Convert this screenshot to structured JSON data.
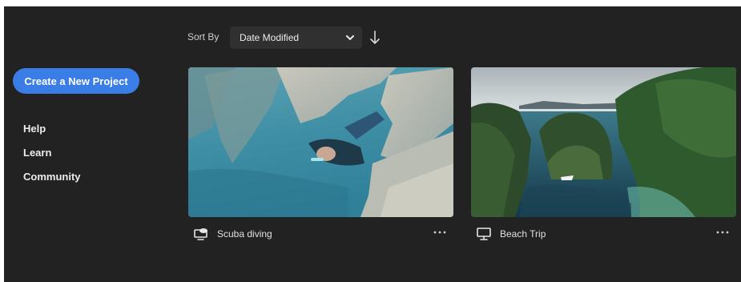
{
  "sidebar": {
    "create_label": "Create a New Project",
    "links": [
      {
        "label": "Help"
      },
      {
        "label": "Learn"
      },
      {
        "label": "Community"
      }
    ]
  },
  "sort": {
    "label": "Sort By",
    "selected": "Date Modified",
    "direction_icon": "arrow-down-icon"
  },
  "projects": [
    {
      "title": "Scuba diving",
      "icon": "cloud-sync-desktop-icon"
    },
    {
      "title": "Beach Trip",
      "icon": "monitor-icon"
    }
  ],
  "colors": {
    "accent": "#3b7de6",
    "background": "#222222",
    "panel": "#303030"
  }
}
